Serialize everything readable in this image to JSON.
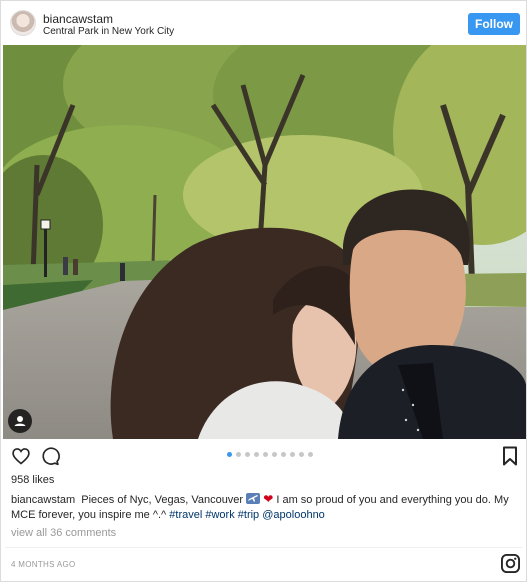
{
  "header": {
    "username": "biancawstam",
    "location": "Central Park in New York City",
    "follow_label": "Follow"
  },
  "icons": {
    "like": "heart-icon",
    "comment": "comment-icon",
    "save": "bookmark-icon",
    "tags": "user-tag-icon",
    "brand": "instagram-icon"
  },
  "carousel": {
    "total": 10,
    "active": 1
  },
  "post": {
    "likes": "958 likes",
    "caption_user": "biancawstam",
    "caption_part1": "Pieces of Nyc, Vegas, Vancouver",
    "caption_part2": "I am so proud of you and everything you do. My MCE forever, you inspire me ^.^",
    "hashtags": [
      "#travel",
      "#work",
      "#trip"
    ],
    "mention": "@apoloohno",
    "view_comments": "view all 36 comments",
    "timestamp": "4 MONTHS AGO"
  },
  "colors": {
    "follow_bg": "#3897f0",
    "link": "#003569",
    "muted": "#999999",
    "heart": "#d0021b"
  }
}
